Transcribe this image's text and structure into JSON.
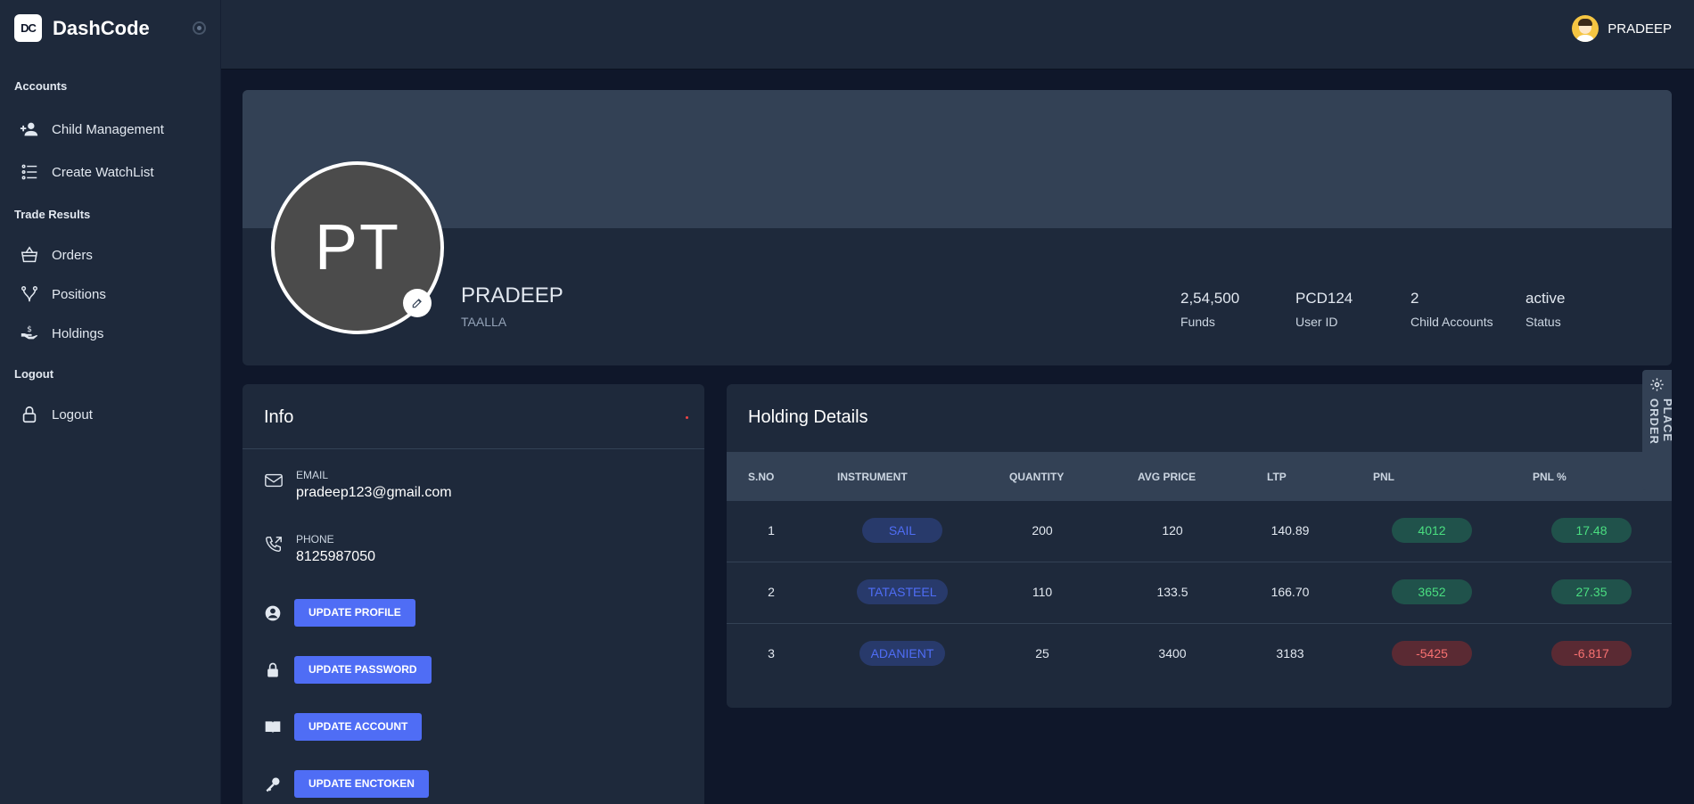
{
  "brand": {
    "logo_text": "DC",
    "name": "DashCode"
  },
  "sidebar": {
    "sections": [
      {
        "title": "Accounts",
        "items": [
          {
            "label": "Child Management",
            "icon": "user-plus-icon"
          },
          {
            "label": "Create WatchList",
            "icon": "list-icon"
          }
        ]
      },
      {
        "title": "Trade Results",
        "items": [
          {
            "label": "Orders",
            "icon": "basket-icon"
          },
          {
            "label": "Positions",
            "icon": "branch-icon"
          },
          {
            "label": "Holdings",
            "icon": "hand-dollar-icon"
          }
        ]
      },
      {
        "title": "Logout",
        "items": [
          {
            "label": "Logout",
            "icon": "lock-icon"
          }
        ]
      }
    ]
  },
  "topbar": {
    "user_name": "PRADEEP"
  },
  "profile": {
    "initials": "PT",
    "name": "PRADEEP",
    "subtitle": "TAALLA",
    "stats": [
      {
        "value": "2,54,500",
        "label": "Funds"
      },
      {
        "value": "PCD124",
        "label": "User ID"
      },
      {
        "value": "2",
        "label": "Child Accounts"
      },
      {
        "value": "active",
        "label": "Status"
      }
    ]
  },
  "info": {
    "title": "Info",
    "email_label": "EMAIL",
    "email": "pradeep123@gmail.com",
    "phone_label": "PHONE",
    "phone": "8125987050",
    "actions": [
      {
        "label": "UPDATE PROFILE",
        "icon": "user-circle-icon"
      },
      {
        "label": "UPDATE PASSWORD",
        "icon": "lock-icon"
      },
      {
        "label": "UPDATE ACCOUNT",
        "icon": "book-icon"
      },
      {
        "label": "UPDATE ENCTOKEN",
        "icon": "key-icon"
      }
    ]
  },
  "holdings": {
    "title": "Holding Details",
    "columns": [
      "S.NO",
      "INSTRUMENT",
      "QUANTITY",
      "AVG PRICE",
      "LTP",
      "PNL",
      "PNL %"
    ],
    "rows": [
      {
        "sno": "1",
        "instrument": "SAIL",
        "quantity": "200",
        "avg_price": "120",
        "ltp": "140.89",
        "pnl": "4012",
        "pnl_pct": "17.48",
        "positive": true
      },
      {
        "sno": "2",
        "instrument": "TATASTEEL",
        "quantity": "110",
        "avg_price": "133.5",
        "ltp": "166.70",
        "pnl": "3652",
        "pnl_pct": "27.35",
        "positive": true
      },
      {
        "sno": "3",
        "instrument": "ADANIENT",
        "quantity": "25",
        "avg_price": "3400",
        "ltp": "3183",
        "pnl": "-5425",
        "pnl_pct": "-6.817",
        "positive": false
      }
    ]
  },
  "place_order": {
    "label": "PLACE ORDER"
  },
  "colors": {
    "accent": "#4f6df5",
    "positive": "#4ade80",
    "negative": "#f87171",
    "background": "#0f172a",
    "card": "#1e293b"
  }
}
